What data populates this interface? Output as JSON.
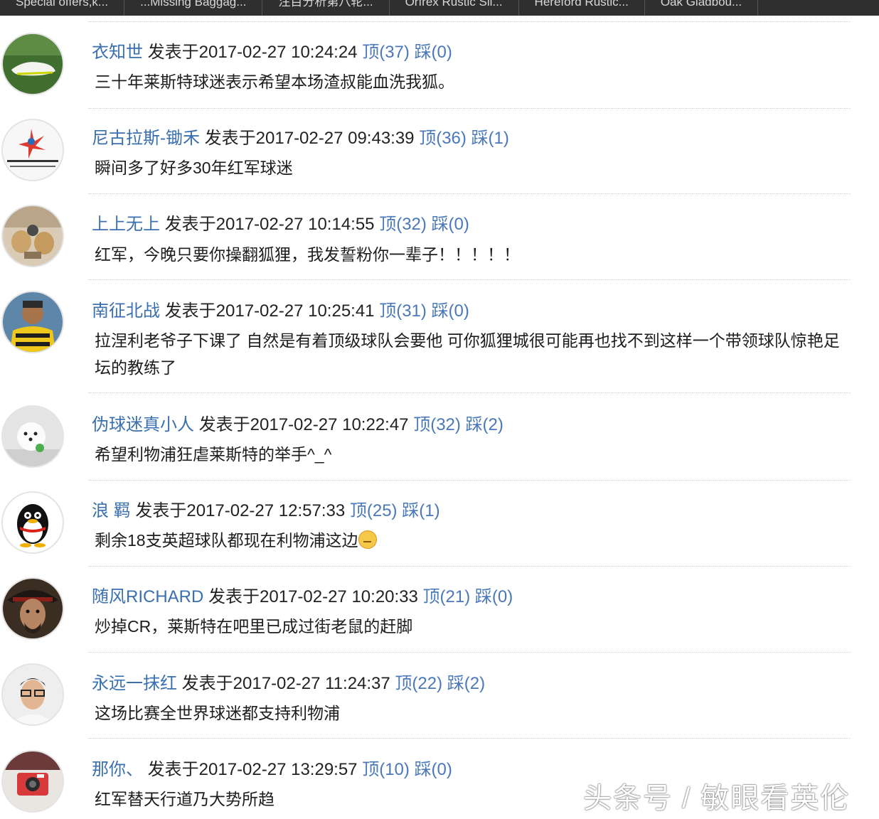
{
  "topbar": {
    "tabs": [
      "Special offers,k...",
      "...Missing Baggag...",
      "注目分析第八轮...",
      "Orfrex Rustic Sli...",
      "Hereford Rustic...",
      "Oak Gladbou..."
    ]
  },
  "comments": [
    {
      "user": "衣知世",
      "posted_label": "发表于",
      "datetime": "2017-02-27 10:24:24",
      "up": "顶(37)",
      "down": "踩(0)",
      "text": "三十年莱斯特球迷表示希望本场渣叔能血洗我狐。",
      "avatar": "football-boot-avatar"
    },
    {
      "user": "尼古拉斯-锄禾",
      "posted_label": "发表于",
      "datetime": "2017-02-27 09:43:39",
      "up": "顶(36)",
      "down": "踩(1)",
      "text": "瞬间多了好多30年红军球迷",
      "avatar": "lottery-logo-avatar"
    },
    {
      "user": "上上无上",
      "posted_label": "发表于",
      "datetime": "2017-02-27 10:14:55",
      "up": "顶(32)",
      "down": "踩(0)",
      "text": "红军，今晚只要你操翻狐狸，我发誓粉你一辈子！！！！！",
      "avatar": "dogs-avatar"
    },
    {
      "user": "南征北战",
      "posted_label": "发表于",
      "datetime": "2017-02-27 10:25:41",
      "up": "顶(31)",
      "down": "踩(0)",
      "text": "拉涅利老爷子下课了 自然是有着顶级球队会要他 可你狐狸城很可能再也找不到这样一个带领球队惊艳足坛的教练了",
      "avatar": "player-avatar"
    },
    {
      "user": "伪球迷真小人",
      "posted_label": "发表于",
      "datetime": "2017-02-27 10:22:47",
      "up": "顶(32)",
      "down": "踩(2)",
      "text": "希望利物浦狂虐莱斯特的举手^_^",
      "avatar": "white-dog-avatar"
    },
    {
      "user": "浪 羁",
      "posted_label": "发表于",
      "datetime": "2017-02-27 12:57:33",
      "up": "顶(25)",
      "down": "踩(1)",
      "text": "剩余18支英超球队都现在利物浦这边",
      "avatar": "penguin-avatar",
      "emoji": "unamused-emoji"
    },
    {
      "user": "随风RICHARD",
      "posted_label": "发表于",
      "datetime": "2017-02-27 10:20:33",
      "up": "顶(21)",
      "down": "踩(0)",
      "text": "炒掉CR，莱斯特在吧里已成过街老鼠的赶脚",
      "avatar": "pirate-avatar"
    },
    {
      "user": "永远一抹红",
      "posted_label": "发表于",
      "datetime": "2017-02-27 11:24:37",
      "up": "顶(22)",
      "down": "踩(2)",
      "text": "这场比赛全世界球迷都支持利物浦",
      "avatar": "man-glasses-avatar"
    },
    {
      "user": "那你、",
      "posted_label": "发表于",
      "datetime": "2017-02-27 13:29:57",
      "up": "顶(10)",
      "down": "踩(0)",
      "text": "红军替天行道乃大势所趋",
      "avatar": "camera-avatar"
    }
  ],
  "watermark": "头条号 / 敏眼看英伦"
}
